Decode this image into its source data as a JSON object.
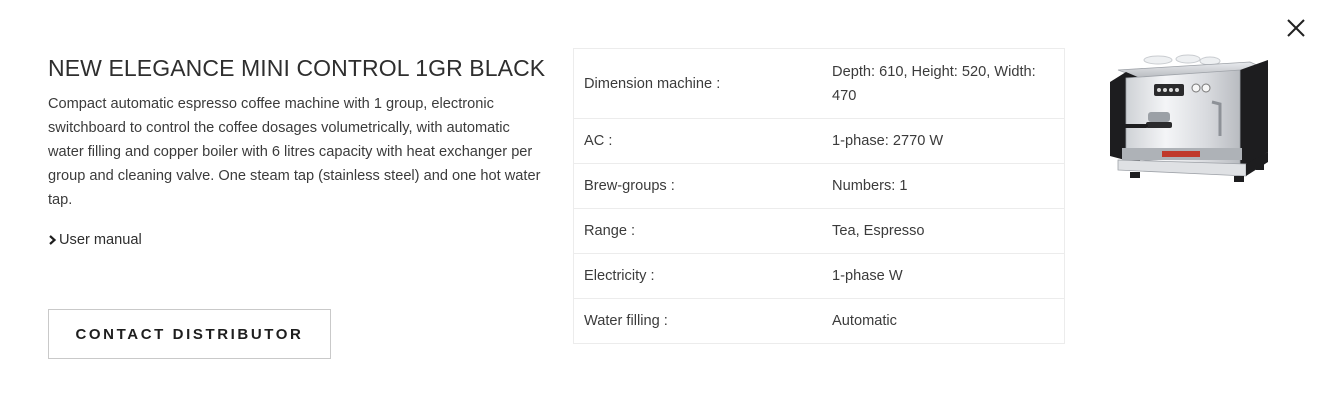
{
  "dialog": {
    "close_icon": "close-icon"
  },
  "product": {
    "title": "NEW ELEGANCE MINI CONTROL 1GR BLACK",
    "description": "Compact automatic espresso coffee machine with 1 group, electronic switchboard to control the coffee dosages volumetrically, with automatic water filling and copper boiler with 6 litres capacity with heat exchanger per group and cleaning valve. One steam tap (stainless steel) and one hot water tap.",
    "manual_label": "User manual",
    "manual_icon": "chevron-right-icon",
    "contact_label": "CONTACT DISTRIBUTOR",
    "image_icon": "espresso-machine-image"
  },
  "specs": [
    {
      "label": "Dimension machine :",
      "value": "Depth: 610, Height: 520, Width: 470"
    },
    {
      "label": "AC :",
      "value": "1-phase: 2770 W"
    },
    {
      "label": "Brew-groups :",
      "value": "Numbers: 1"
    },
    {
      "label": "Range :",
      "value": "Tea, Espresso"
    },
    {
      "label": "Electricity :",
      "value": "1-phase W"
    },
    {
      "label": "Water filling :",
      "value": "Automatic"
    }
  ],
  "colors": {
    "text": "#333333",
    "border": "#ececec",
    "button_border": "#c9c9c9"
  }
}
